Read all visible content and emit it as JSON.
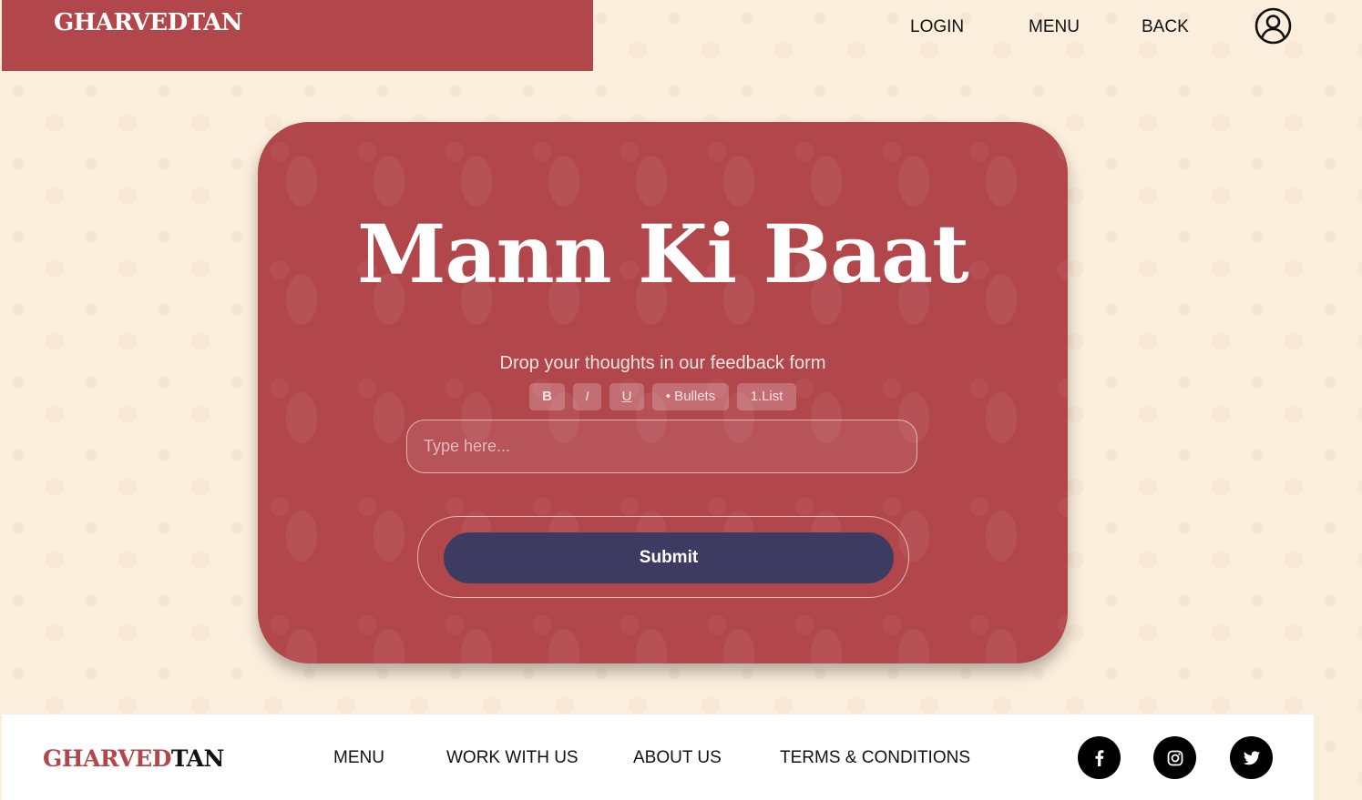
{
  "header": {
    "brand": "GHARVEDTAN",
    "nav": [
      "LOGIN",
      "MENU",
      "BACK"
    ]
  },
  "card": {
    "title": "Mann Ki Baat",
    "subtitle": "Drop your thoughts in our feedback form",
    "toolbar": [
      "B",
      "I",
      "U",
      "• Bullets",
      "1.List"
    ],
    "input_placeholder": "Type here...",
    "submit_label": "Submit"
  },
  "footer": {
    "brand_accent": "GHARVED",
    "brand_dark": "TAN",
    "links": [
      "MENU",
      "WORK WITH US",
      "ABOUT US",
      "TERMS & CONDITIONS"
    ],
    "social_icons": [
      "facebook-icon",
      "instagram-icon",
      "twitter-icon"
    ]
  },
  "colors": {
    "brand_red": "#b1464b",
    "submit_bg": "#3d3b61",
    "page_bg": "#fbeedd"
  }
}
